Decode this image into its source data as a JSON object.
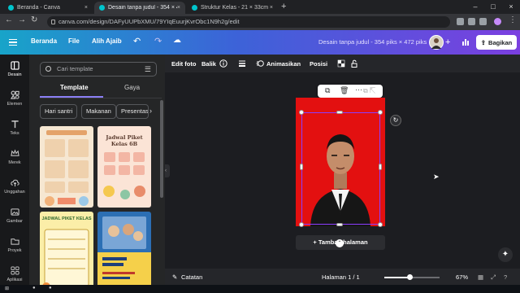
{
  "browser": {
    "tabs": [
      {
        "title": "Beranda - Canva",
        "close": "×"
      },
      {
        "title": "Desain tanpa judul - 354 × 472p",
        "close": "×"
      },
      {
        "title": "Struktur Kelas - 21 × 33cm",
        "close": "×"
      }
    ],
    "new_tab": "+",
    "url": "canva.com/design/DAFyUUPbXMU/79YIqEuurjKvrObc1N9h2g/edit",
    "window_controls": [
      "–",
      "□",
      "×"
    ]
  },
  "header": {
    "menu": [
      "Beranda",
      "File",
      "Alih Ajaib"
    ],
    "undo": "↶",
    "redo": "↷",
    "cloud": "☁",
    "doc_title": "Desain tanpa judul - 354 piks × 472 piks",
    "plus": "+",
    "share_label": "Bagikan",
    "share_icon": "⇪"
  },
  "rail": {
    "items": [
      {
        "label": "Desain",
        "icon": "layout-icon",
        "active": true
      },
      {
        "label": "Elemen",
        "icon": "shapes-icon",
        "active": false
      },
      {
        "label": "Teks",
        "icon": "text-icon",
        "active": false
      },
      {
        "label": "Merek",
        "icon": "crown-icon",
        "active": false
      },
      {
        "label": "Unggahan",
        "icon": "cloud-upload-icon",
        "active": false
      },
      {
        "label": "Gambar",
        "icon": "image-icon",
        "active": false
      },
      {
        "label": "Proyek",
        "icon": "folder-icon",
        "active": false
      },
      {
        "label": "Aplikasi",
        "icon": "apps-icon",
        "active": false
      }
    ]
  },
  "panel": {
    "search_placeholder": "Cari template",
    "tabs": [
      "Template",
      "Gaya"
    ],
    "chips": [
      "Hari santri",
      "Makanan",
      "Presentasi"
    ],
    "chip_next": "›",
    "thumb_titles": [
      "Jadwal Piket Kelas 6B",
      "JADWAL PIKET KELAS"
    ]
  },
  "canvas": {
    "toolbar": [
      "Edit foto",
      "Balik",
      "Animasikan",
      "Posisi"
    ],
    "add_page": "+ Tambah halaman",
    "rotate": "↻",
    "sparkle": "✦"
  },
  "footer": {
    "notes": "Catatan",
    "page": "Halaman 1 / 1",
    "zoom": "67%",
    "zoom_fraction": 0.45
  },
  "colors": {
    "page_bg": "#e31010",
    "accent": "#8b3dff",
    "header_from": "#18a4c9",
    "header_to": "#7b3fe0"
  }
}
